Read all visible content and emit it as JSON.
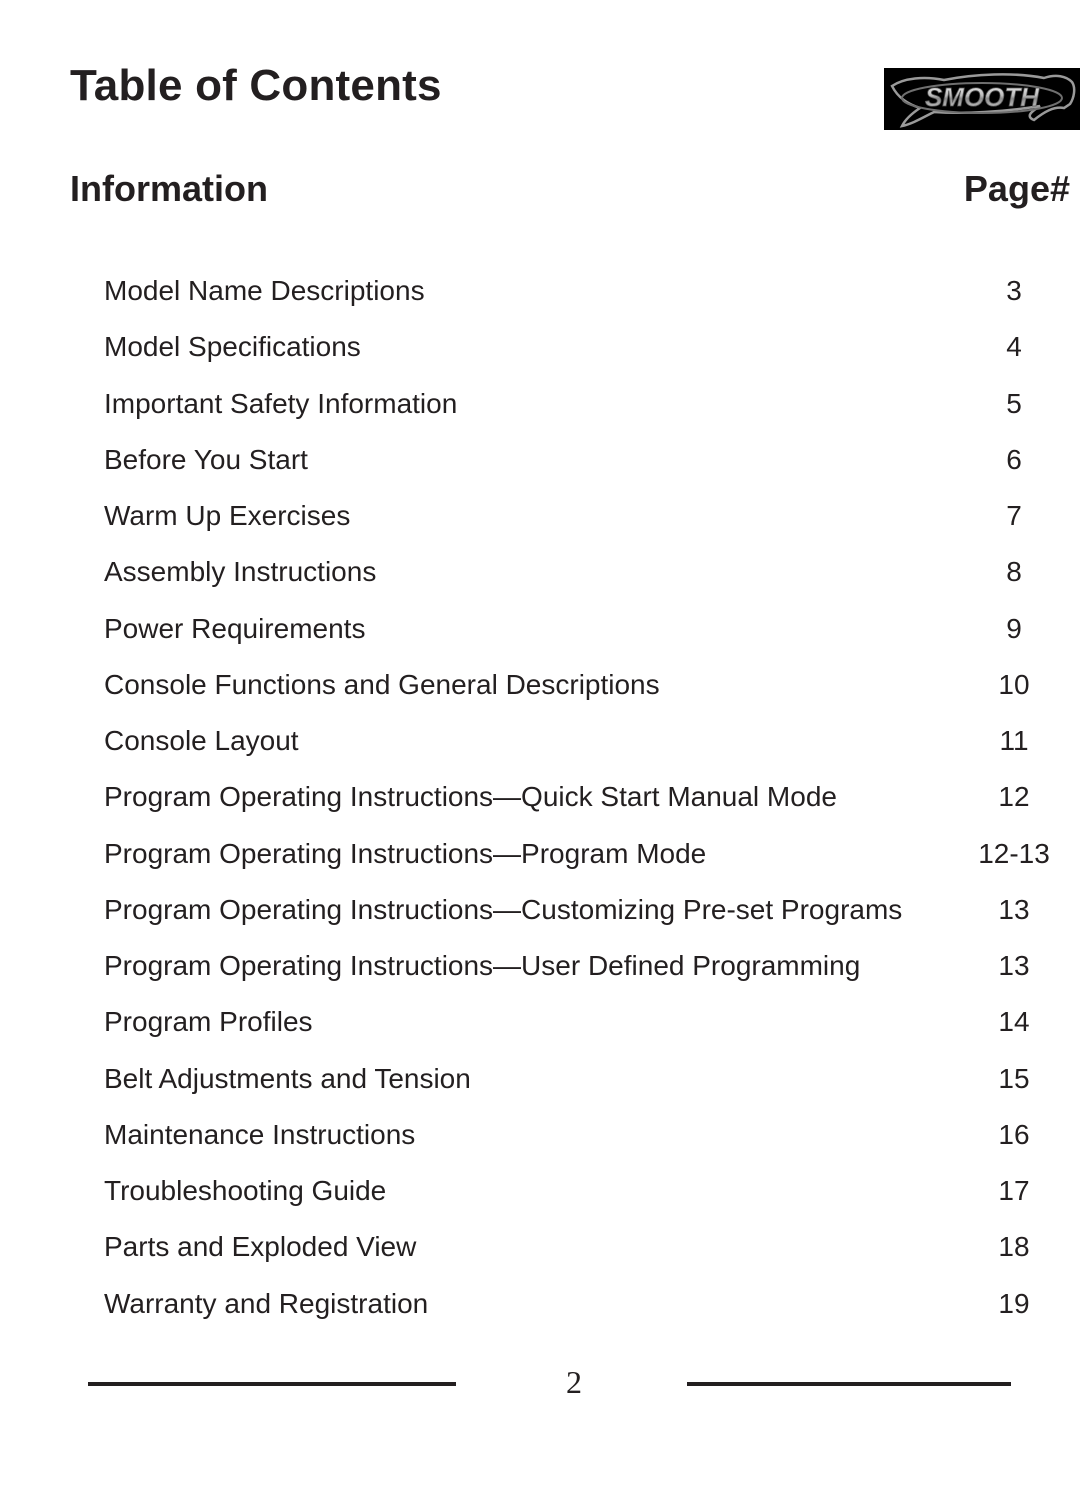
{
  "header": {
    "title": "Table of Contents",
    "logo": {
      "text": "SMOOTH",
      "icon": "leaping-cat-logo-icon",
      "background_color": "#000000",
      "text_color": "#c8c8c8"
    }
  },
  "columns": {
    "information_label": "Information",
    "page_label": "Page#"
  },
  "toc": {
    "entries": [
      {
        "label": "Model Name Descriptions",
        "page": "3"
      },
      {
        "label": "Model Specifications",
        "page": "4"
      },
      {
        "label": "Important Safety Information",
        "page": "5"
      },
      {
        "label": "Before You Start",
        "page": "6"
      },
      {
        "label": "Warm Up Exercises",
        "page": "7"
      },
      {
        "label": "Assembly Instructions",
        "page": "8"
      },
      {
        "label": "Power Requirements",
        "page": "9"
      },
      {
        "label": "Console Functions and General Descriptions",
        "page": "10"
      },
      {
        "label": "Console Layout",
        "page": "11"
      },
      {
        "label": "Program Operating Instructions—Quick Start Manual Mode",
        "page": "12"
      },
      {
        "label": "Program Operating Instructions—Program Mode",
        "page": "12-13"
      },
      {
        "label": "Program Operating Instructions—Customizing Pre-set Programs",
        "page": "13"
      },
      {
        "label": "Program Operating Instructions—User Defined Programming",
        "page": "13"
      },
      {
        "label": "Program Profiles",
        "page": "14"
      },
      {
        "label": "Belt Adjustments and Tension",
        "page": "15"
      },
      {
        "label": "Maintenance Instructions",
        "page": "16"
      },
      {
        "label": "Troubleshooting Guide",
        "page": "17"
      },
      {
        "label": "Parts and Exploded View",
        "page": "18"
      },
      {
        "label": "Warranty and Registration",
        "page": "19"
      }
    ]
  },
  "footer": {
    "page_number": "2"
  }
}
